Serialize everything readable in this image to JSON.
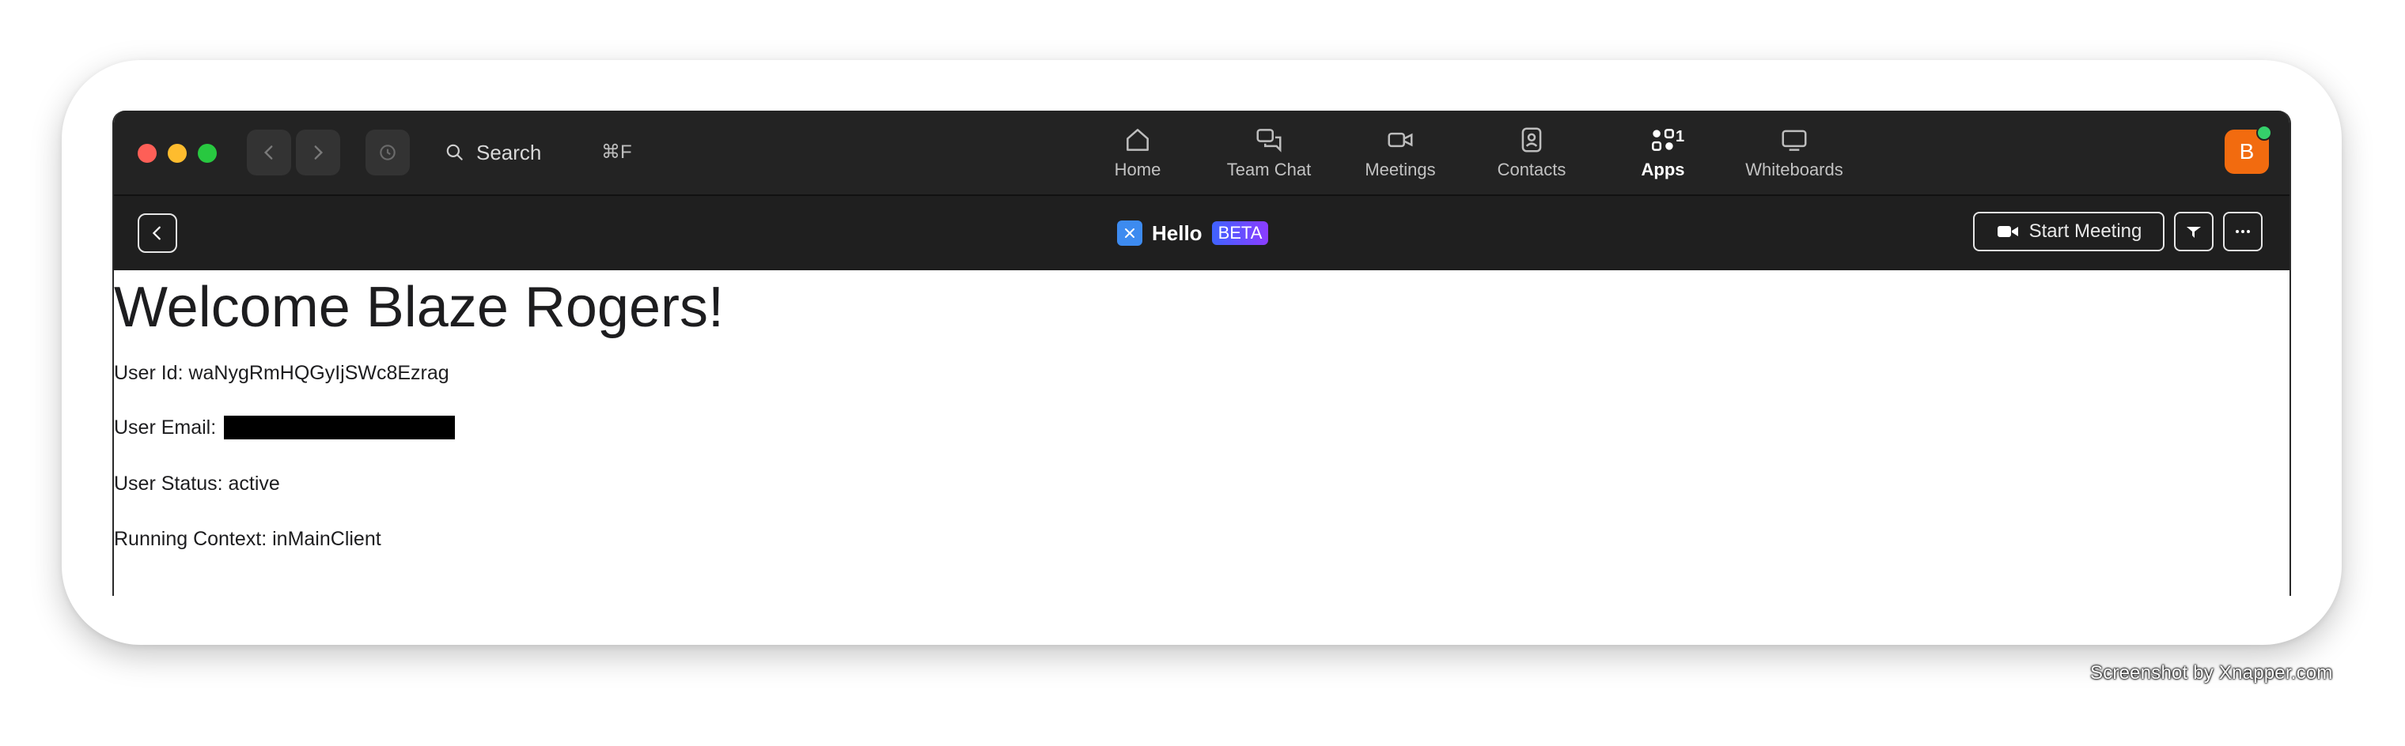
{
  "titlebar": {
    "search_label": "Search",
    "search_shortcut": "⌘F",
    "tabs": [
      {
        "label": "Home",
        "icon": "home-icon"
      },
      {
        "label": "Team Chat",
        "icon": "chat-bubbles-icon"
      },
      {
        "label": "Meetings",
        "icon": "video-camera-icon"
      },
      {
        "label": "Contacts",
        "icon": "contact-card-icon"
      },
      {
        "label": "Apps",
        "icon": "apps-icon",
        "badge": "1",
        "active": true
      },
      {
        "label": "Whiteboards",
        "icon": "whiteboard-icon"
      }
    ],
    "avatar_initial": "B"
  },
  "app_header": {
    "title": "Hello",
    "badge": "BETA",
    "start_meeting_label": "Start Meeting"
  },
  "content": {
    "heading": "Welcome Blaze Rogers!",
    "user_id_label": "User Id: waNygRmHQGyIjSWc8Ezrag",
    "user_email_label": "User Email:",
    "user_status_label": "User Status: active",
    "running_context_label": "Running Context: inMainClient"
  },
  "watermark": "Screenshot by Xnapper.com",
  "colors": {
    "titlebar_bg": "#232323",
    "avatar_bg": "#f26b0f",
    "beta_gradient_start": "#3f63ff",
    "beta_gradient_end": "#8b3cff"
  }
}
